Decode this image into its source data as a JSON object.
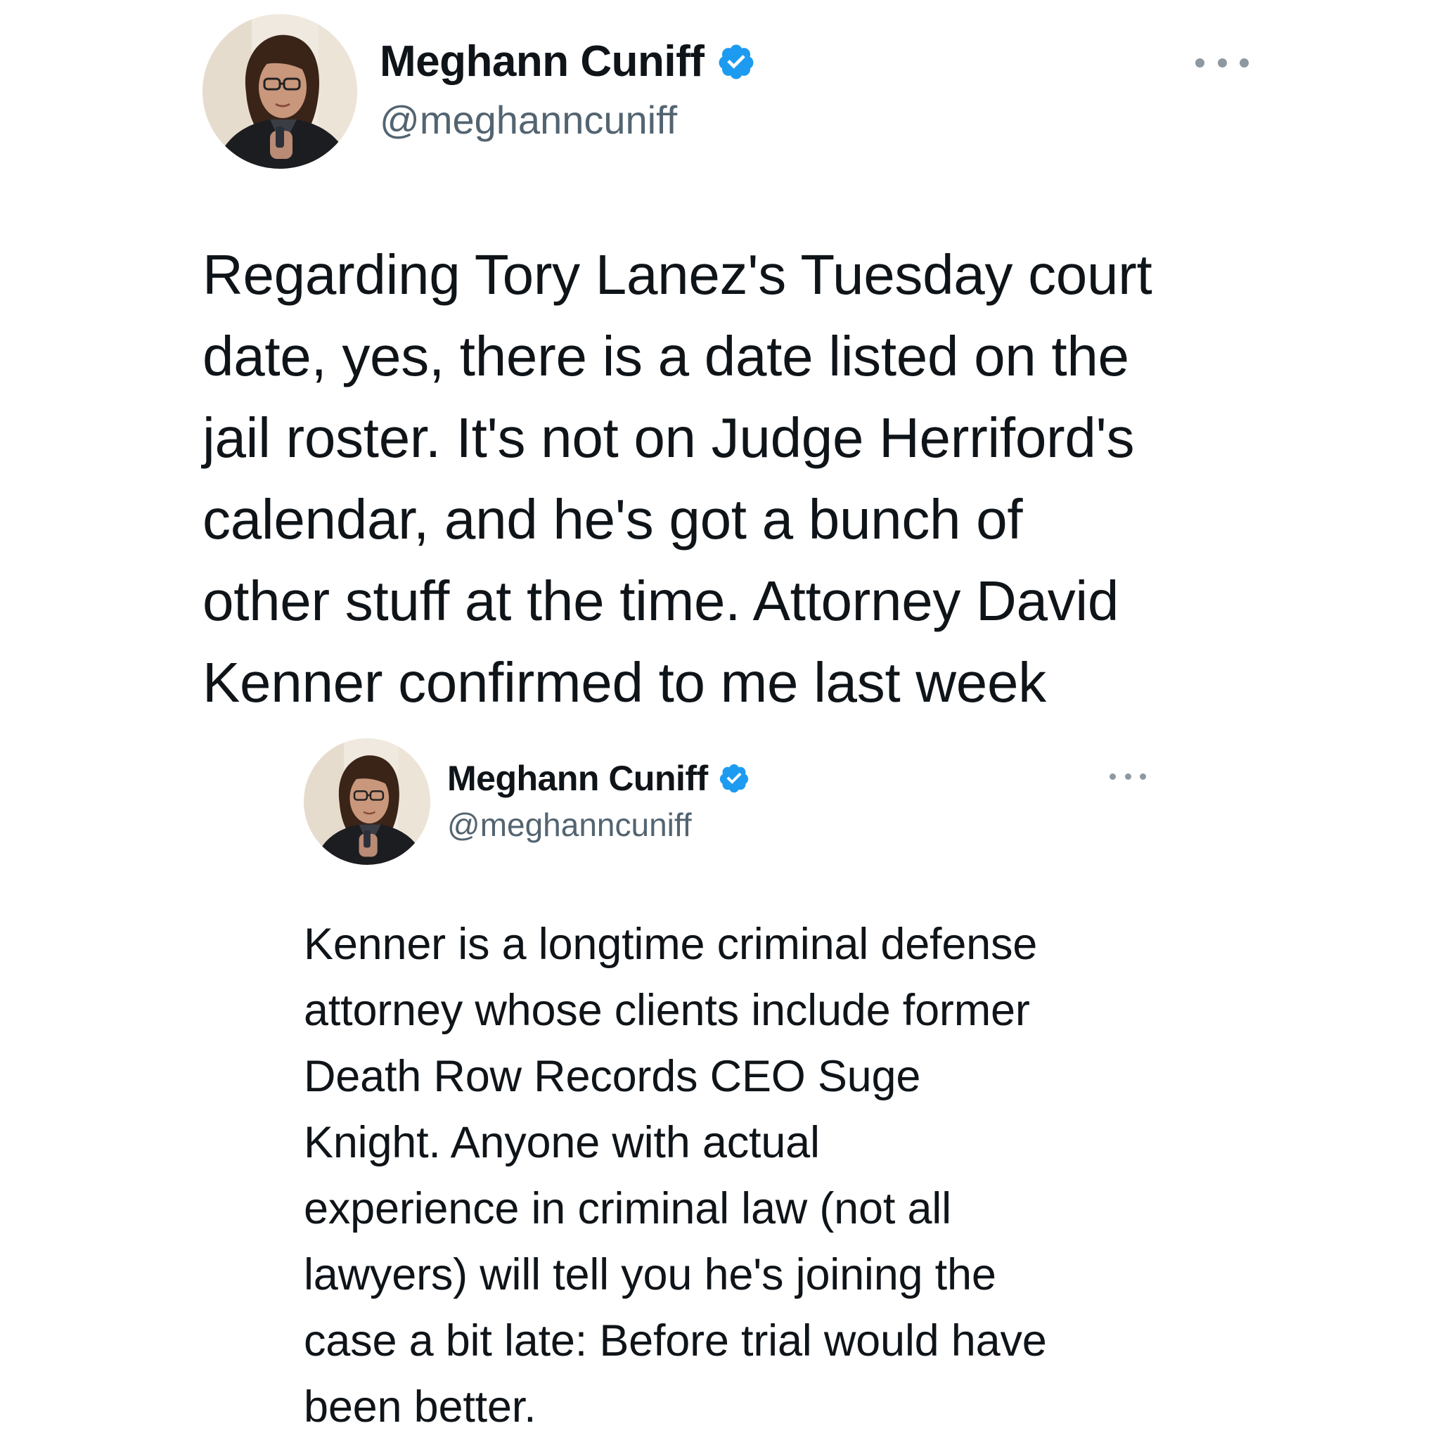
{
  "main_tweet": {
    "display_name": "Meghann Cuniff",
    "handle": "@meghanncuniff",
    "text_lines": [
      "Regarding Tory Lanez's Tuesday court",
      "date, yes, there is a date listed on the",
      "jail roster. It's not on Judge Herriford's",
      "calendar, and he's got a bunch of",
      "other stuff at the time. Attorney David",
      "Kenner confirmed to me last week"
    ]
  },
  "quoted_tweet": {
    "display_name": "Meghann Cuniff",
    "handle": "@meghanncuniff",
    "text_lines": [
      "Kenner is a longtime criminal defense",
      "attorney whose clients include former",
      "Death Row Records CEO Suge",
      "Knight. Anyone with actual",
      "experience in criminal law (not all",
      "lawyers) will tell you he's joining the",
      "case a bit late: Before trial would have",
      "been better."
    ]
  },
  "icons": {
    "verified": "verified-badge-icon",
    "more": "more-options-icon"
  },
  "colors": {
    "text": "#0f1419",
    "secondary_text": "#536471",
    "verified_blue": "#1d9bf0",
    "background": "#ffffff"
  }
}
